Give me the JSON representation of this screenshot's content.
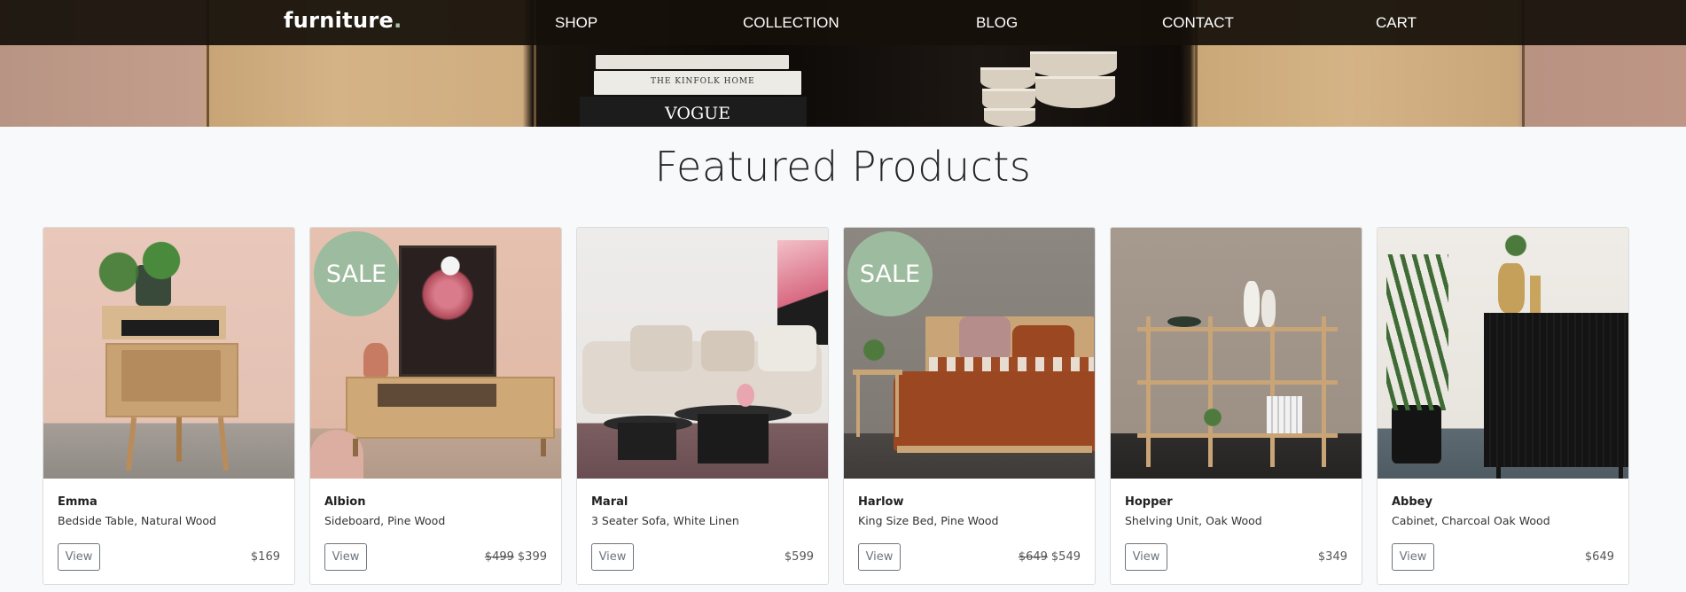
{
  "navbar": {
    "brand": "furniture",
    "brand_dot": ".",
    "links": [
      {
        "label": "SHOP"
      },
      {
        "label": "COLLECTION"
      },
      {
        "label": "BLOG"
      },
      {
        "label": "CONTACT"
      },
      {
        "label": "CART"
      }
    ]
  },
  "hero": {
    "book_texts": [
      "THE KINFOLK HOME",
      "VOGUE"
    ]
  },
  "section": {
    "title": "Featured Products"
  },
  "products": [
    {
      "name": "Emma",
      "desc": "Bedside Table, Natural Wood",
      "price": "$169",
      "old_price": "",
      "sale": false,
      "button": "View"
    },
    {
      "name": "Albion",
      "desc": "Sideboard, Pine Wood",
      "price": "$399",
      "old_price": "$499",
      "sale": true,
      "sale_label": "SALE",
      "button": "View"
    },
    {
      "name": "Maral",
      "desc": "3 Seater Sofa, White Linen",
      "price": "$599",
      "old_price": "",
      "sale": false,
      "button": "View"
    },
    {
      "name": "Harlow",
      "desc": "King Size Bed, Pine Wood",
      "price": "$549",
      "old_price": "$649",
      "sale": true,
      "sale_label": "SALE",
      "button": "View"
    },
    {
      "name": "Hopper",
      "desc": "Shelving Unit, Oak Wood",
      "price": "$349",
      "old_price": "",
      "sale": false,
      "button": "View"
    },
    {
      "name": "Abbey",
      "desc": "Cabinet, Charcoal Oak Wood",
      "price": "$649",
      "old_price": "",
      "sale": false,
      "button": "View"
    }
  ],
  "colors": {
    "nav_bg": "#16100a",
    "sale_badge": "#9dbb9e",
    "page_bg": "#f8f9fa"
  }
}
